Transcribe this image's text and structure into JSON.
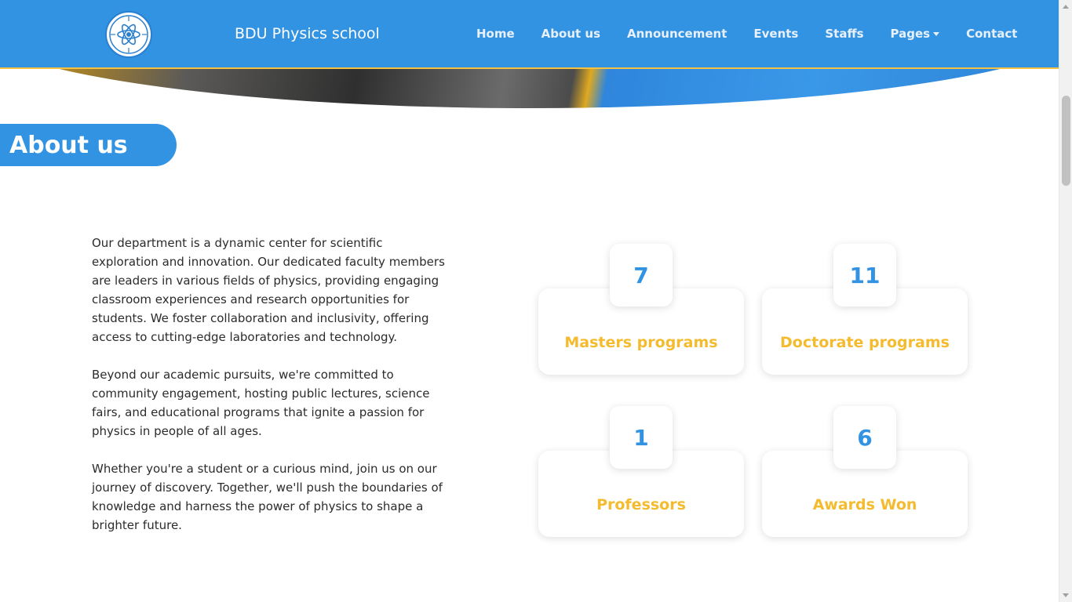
{
  "header": {
    "brand": "BDU Physics school",
    "logo_icon": "atom-emblem-icon",
    "nav": [
      {
        "label": "Home"
      },
      {
        "label": "About us"
      },
      {
        "label": "Announcement"
      },
      {
        "label": "Events"
      },
      {
        "label": "Staffs"
      },
      {
        "label": "Pages",
        "dropdown": true
      },
      {
        "label": "Contact"
      }
    ]
  },
  "section": {
    "title": "About us"
  },
  "about": {
    "paragraphs": [
      "Our department is a dynamic center for scientific exploration and innovation. Our dedicated faculty members are leaders in various fields of physics, providing engaging classroom experiences and research opportunities for students. We foster collaboration and inclusivity, offering access to cutting-edge laboratories and technology.",
      "Beyond our academic pursuits, we're committed to community engagement, hosting public lectures, science fairs, and educational programs that ignite a passion for physics in people of all ages.",
      "Whether you're a student or a curious mind, join us on our journey of discovery. Together, we'll push the boundaries of knowledge and harness the power of physics to shape a brighter future."
    ]
  },
  "stats": [
    {
      "number": "7",
      "label": "Masters programs"
    },
    {
      "number": "11",
      "label": "Doctorate programs"
    },
    {
      "number": "1",
      "label": "Professors"
    },
    {
      "number": "6",
      "label": "Awards Won"
    }
  ],
  "colors": {
    "primary": "#3393e3",
    "accent": "#f4bb2f",
    "text": "#2b2b2b",
    "background": "#ffffff"
  }
}
